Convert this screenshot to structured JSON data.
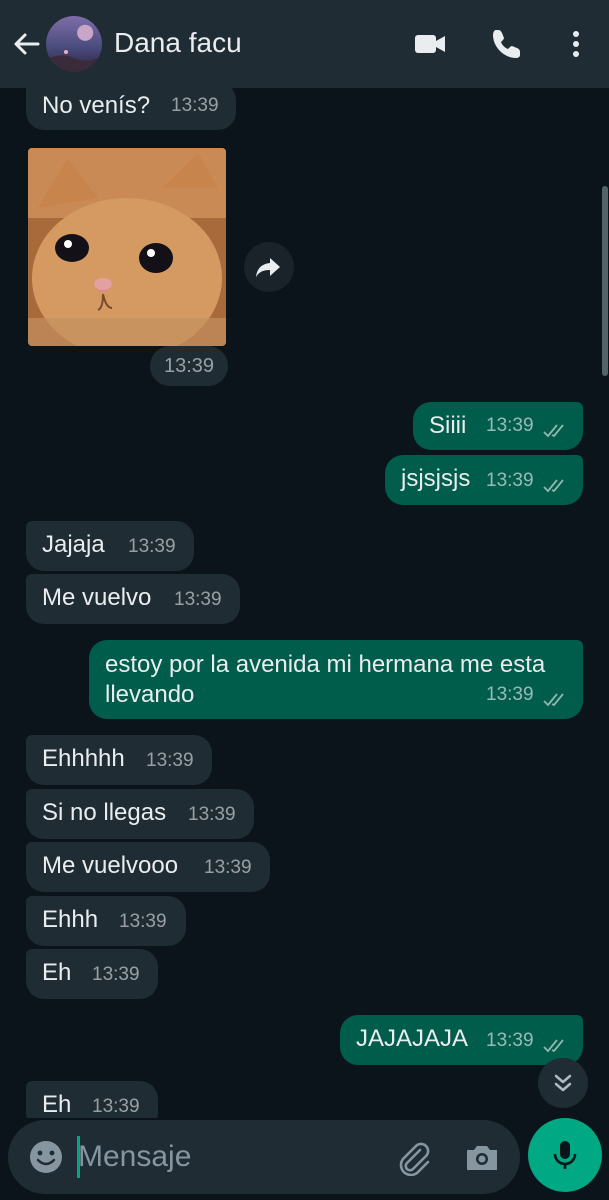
{
  "header": {
    "contact_name": "Dana facu",
    "icons": [
      "back-arrow-icon",
      "avatar",
      "video-call-icon",
      "phone-icon",
      "more-vert-icon"
    ]
  },
  "messages": [
    {
      "dir": "in",
      "text": "No venís?",
      "time": "13:39"
    },
    {
      "dir": "in",
      "type": "image",
      "image": "crying-kitten",
      "time": "13:39"
    },
    {
      "dir": "out",
      "text": "Siiii",
      "time": "13:39",
      "status": "read"
    },
    {
      "dir": "out",
      "text": "jsjsjsjs",
      "time": "13:39",
      "status": "read"
    },
    {
      "dir": "in",
      "text": "Jajaja",
      "time": "13:39"
    },
    {
      "dir": "in",
      "text": "Me vuelvo",
      "time": "13:39"
    },
    {
      "dir": "out",
      "text_line1": "estoy por la avenida mi hermana me esta",
      "text_line2": "llevando",
      "time": "13:39",
      "status": "read"
    },
    {
      "dir": "in",
      "text": "Ehhhhh",
      "time": "13:39"
    },
    {
      "dir": "in",
      "text": "Si no llegas",
      "time": "13:39"
    },
    {
      "dir": "in",
      "text": "Me vuelvooo",
      "time": "13:39"
    },
    {
      "dir": "in",
      "text": "Ehhh",
      "time": "13:39"
    },
    {
      "dir": "in",
      "text": "Eh",
      "time": "13:39"
    },
    {
      "dir": "out",
      "text": "JAJAJAJA",
      "time": "13:39",
      "status": "read"
    },
    {
      "dir": "in",
      "text": "Eh",
      "time": "13:39"
    }
  ],
  "composer": {
    "placeholder": "Mensaje"
  },
  "colors": {
    "background": "#0b141a",
    "header": "#1f2c34",
    "incoming_bubble": "#1f2c34",
    "outgoing_bubble": "#005c4b",
    "accent": "#00a884"
  }
}
